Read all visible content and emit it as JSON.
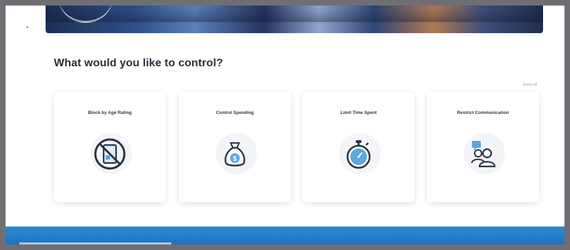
{
  "page": {
    "title": "What would you like to control?",
    "select_all": "Select all"
  },
  "cards": [
    {
      "label": "Block by Age Rating",
      "icon": "blocked-tablet-icon"
    },
    {
      "label": "Control Spending",
      "icon": "money-bag-icon"
    },
    {
      "label": "Limit Time Spent",
      "icon": "stopwatch-icon"
    },
    {
      "label": "Restrict Communication",
      "icon": "people-chat-icon"
    }
  ],
  "colors": {
    "accent_blue": "#2c8bd6",
    "icon_blue": "#5aa8e0",
    "icon_dark": "#2b3340",
    "title_text": "#2a2f3a"
  }
}
